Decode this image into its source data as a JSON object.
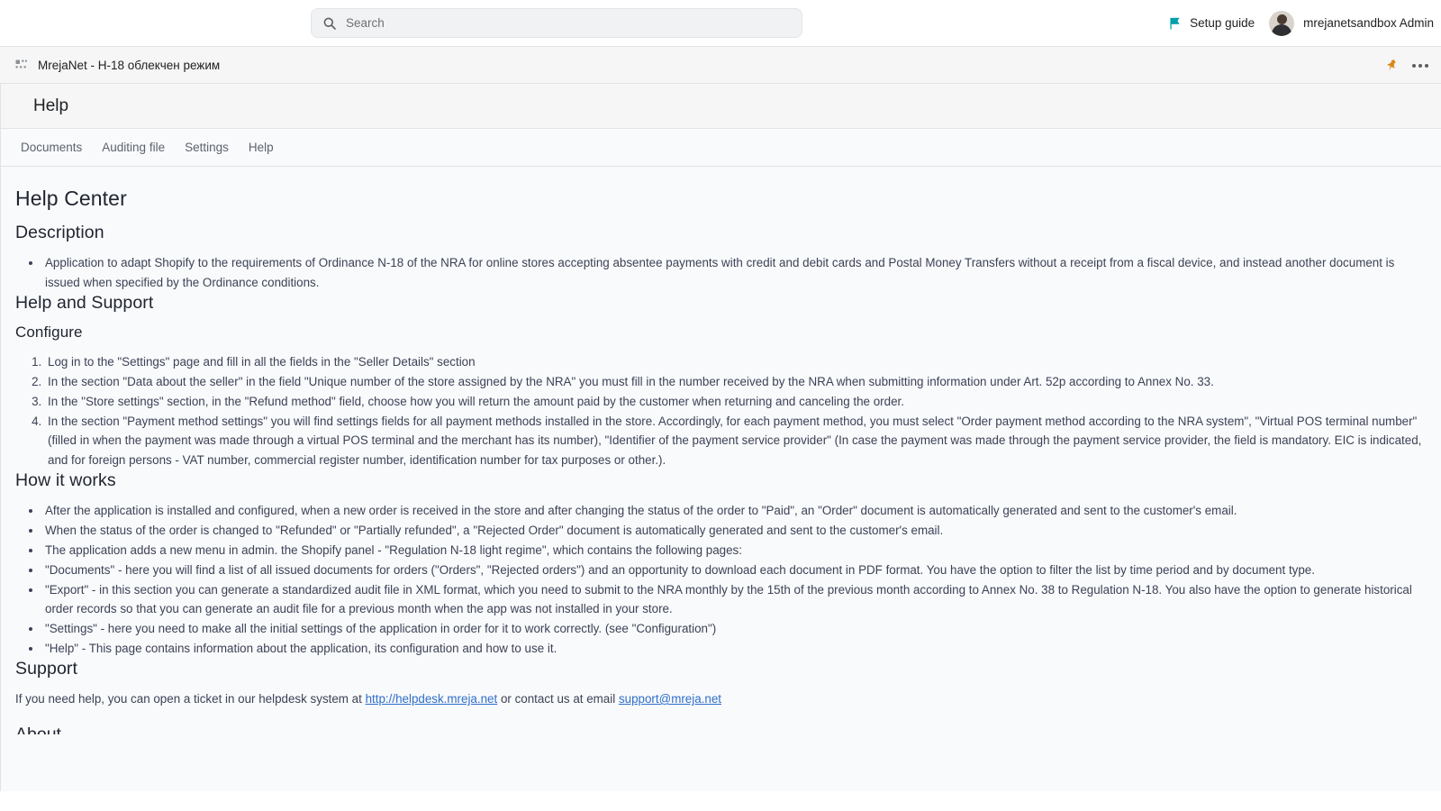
{
  "topbar": {
    "search": {
      "placeholder": "Search",
      "value": "",
      "icon": "search-icon"
    },
    "setup_guide_label": "Setup guide",
    "setup_guide_icon": "flag-icon",
    "user_name": "mrejanetsandbox Admin",
    "accent_teal": "#00a0ac"
  },
  "appbar": {
    "app_title": "MrejaNet - Н-18 облекчен режим",
    "app_icon": "apps-grid-icon",
    "pin_icon": "pin-icon",
    "pin_color": "#d98a15",
    "more_icon": "ellipsis-icon"
  },
  "page": {
    "title": "Help"
  },
  "nav": {
    "items": [
      {
        "label": "Documents",
        "name": "documents"
      },
      {
        "label": "Auditing file",
        "name": "auditing-file"
      },
      {
        "label": "Settings",
        "name": "settings"
      },
      {
        "label": "Help",
        "name": "help"
      }
    ]
  },
  "doc": {
    "h1": "Help Center",
    "description_heading": "Description",
    "description_items": [
      "Application to adapt Shopify to the requirements of Ordinance N-18 of the NRA for online stores accepting absentee payments with credit and debit cards and Postal Money Transfers without a receipt from a fiscal device, and instead another document is issued when specified by the Ordinance conditions."
    ],
    "help_support_heading": "Help and Support",
    "configure_heading": "Configure",
    "configure_steps": [
      "Log in to the \"Settings\" page and fill in all the fields in the \"Seller Details\" section",
      "In the section \"Data about the seller\" in the field \"Unique number of the store assigned by the NRA\" you must fill in the number received by the NRA when submitting information under Art. 52p according to Annex No. 33.",
      "In the \"Store settings\" section, in the \"Refund method\" field, choose how you will return the amount paid by the customer when returning and canceling the order.",
      "In the section \"Payment method settings\" you will find settings fields for all payment methods installed in the store. Accordingly, for each payment method, you must select \"Order payment method according to the NRA system\", \"Virtual POS terminal number\" (filled in when the payment was made through a virtual POS terminal and the merchant has its number), \"Identifier of the payment service provider\" (In case the payment was made through the payment service provider, the field is mandatory. EIC is indicated, and for foreign persons - VAT number, commercial register number, identification number for tax purposes or other.)."
    ],
    "how_it_works_heading": "How it works",
    "how_it_works_items": [
      "After the application is installed and configured, when a new order is received in the store and after changing the status of the order to \"Paid\", an \"Order\" document is automatically generated and sent to the customer's email.",
      "When the status of the order is changed to \"Refunded\" or \"Partially refunded\", a \"Rejected Order\" document is automatically generated and sent to the customer's email.",
      "The application adds a new menu in admin. the Shopify panel - \"Regulation N-18 light regime\", which contains the following pages:",
      "\"Documents\" - here you will find a list of all issued documents for orders (\"Orders\", \"Rejected orders\") and an opportunity to download each document in PDF format. You have the option to filter the list by time period and by document type.",
      "\"Export\" - in this section you can generate a standardized audit file in XML format, which you need to submit to the NRA monthly by the 15th of the previous month according to Annex No. 38 to Regulation N-18. You also have the option to generate historical order records so that you can generate an audit file for a previous month when the app was not installed in your store.",
      "\"Settings\" - here you need to make all the initial settings of the application in order for it to work correctly. (see \"Configuration\")",
      "\"Help\" - This page contains information about the application, its configuration and how to use it."
    ],
    "support_heading": "Support",
    "support_text_before": "If you need help, you can open a ticket in our helpdesk system at ",
    "support_link_url_text": "http://helpdesk.mreja.net",
    "support_text_middle": " or contact us at email ",
    "support_link_email_text": "support@mreja.net",
    "next_heading_partial": "About"
  }
}
